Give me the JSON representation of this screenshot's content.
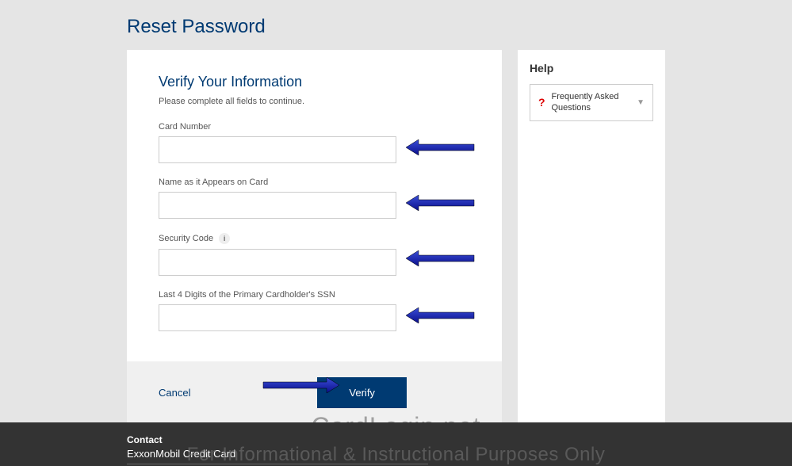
{
  "page_title": "Reset Password",
  "form": {
    "heading": "Verify Your Information",
    "subtext": "Please complete all fields to continue.",
    "fields": {
      "card_number": {
        "label": "Card Number",
        "value": ""
      },
      "name_on_card": {
        "label": "Name as it Appears on Card",
        "value": ""
      },
      "security_code": {
        "label": "Security Code",
        "value": ""
      },
      "ssn_last4": {
        "label": "Last 4 Digits of the Primary Cardholder's SSN",
        "value": ""
      }
    },
    "cancel_label": "Cancel",
    "verify_label": "Verify"
  },
  "help": {
    "title": "Help",
    "faq_label": "Frequently Asked Questions",
    "faq_icon": "?"
  },
  "footer": {
    "contact_label": "Contact",
    "contact_name": "ExxonMobil Credit Card"
  },
  "watermark": {
    "line1": "CardLogin.net",
    "line2": "For Informational & Instructional Purposes Only"
  }
}
